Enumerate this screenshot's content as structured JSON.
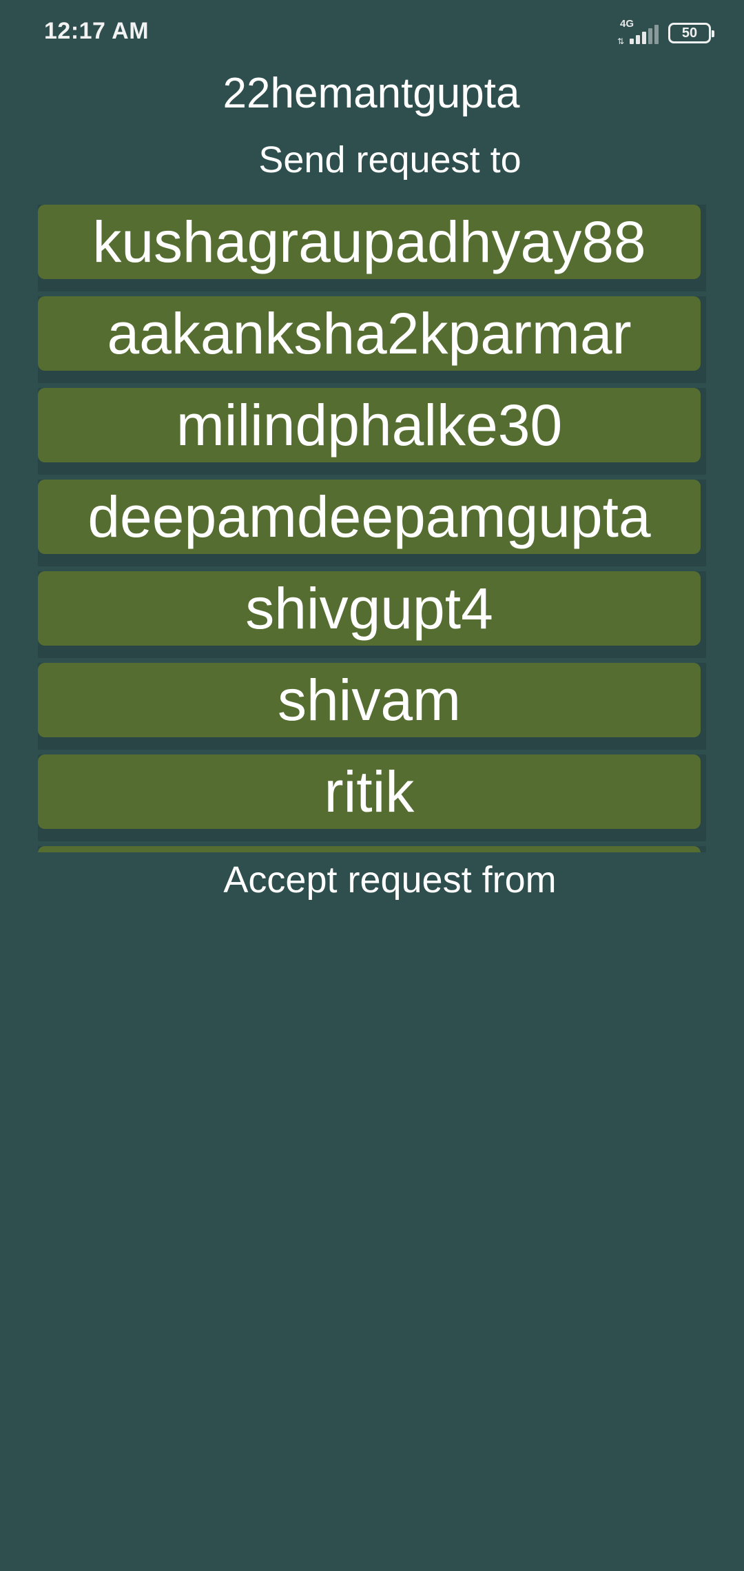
{
  "status_bar": {
    "time": "12:17 AM",
    "network": "4G",
    "battery": "50"
  },
  "header": {
    "username": "22hemantgupta"
  },
  "send_section": {
    "title": "Send request to",
    "users": [
      "kushagraupadhyay88",
      "aakanksha2kparmar",
      "milindphalke30",
      "deepamdeepamgupta",
      "shivgupt4",
      "shivam",
      "ritik"
    ]
  },
  "accept_section": {
    "title": "Accept request from"
  },
  "colors": {
    "background": "#2f4f4f",
    "button": "#566d31",
    "text": "#ffffff"
  },
  "icons": [
    "network-4g-icon",
    "signal-strength-icon",
    "battery-icon"
  ]
}
